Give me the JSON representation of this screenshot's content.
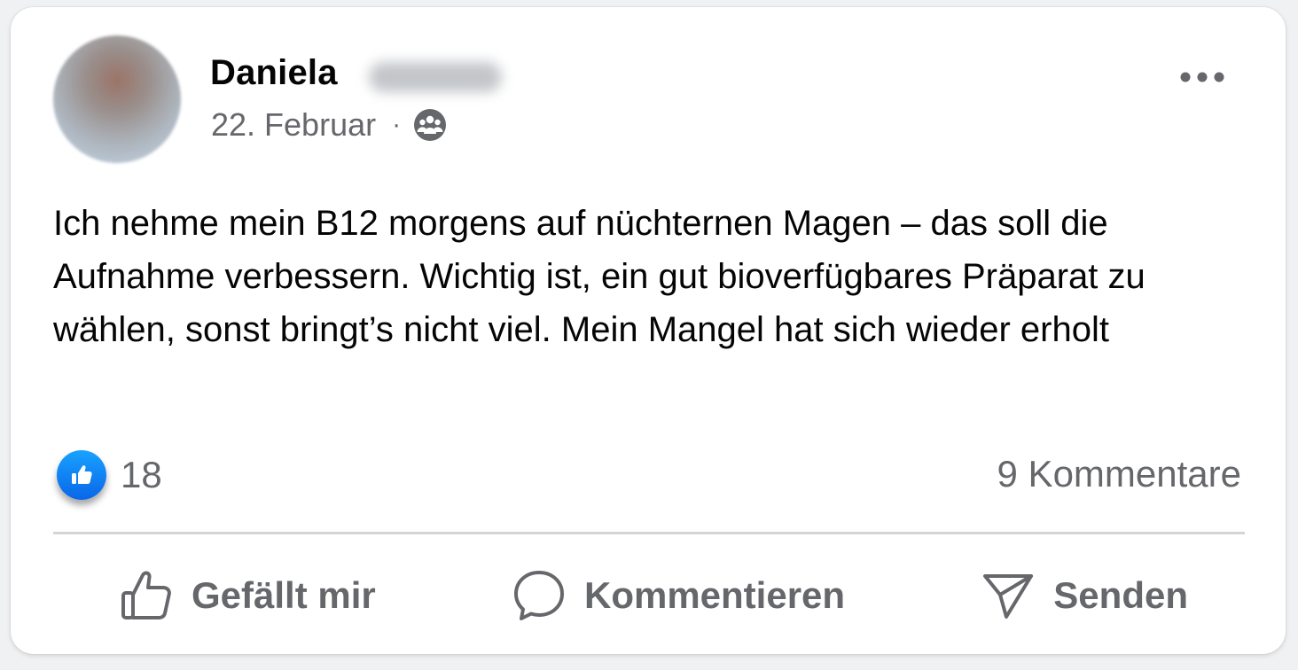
{
  "post": {
    "author_first_name": "Daniela",
    "date": "22. Februar",
    "separator": "·",
    "audience_icon": "group-icon",
    "text": "Ich nehme mein B12 morgens auf nüchternen Magen – das soll die Aufnahme verbessern. Wichtig ist, ein gut bioverfügbares Präparat zu wählen, sonst bringt’s nicht viel. Mein Mangel hat sich wieder erholt"
  },
  "stats": {
    "likes": "18",
    "comments": "9 Kommentare"
  },
  "actions": {
    "like_label": "Gefällt mir",
    "comment_label": "Kommentieren",
    "send_label": "Senden"
  },
  "colors": {
    "text_primary": "#050505",
    "text_secondary": "#65676b",
    "like_blue": "#0a66e8",
    "divider": "#d3d5d8"
  }
}
